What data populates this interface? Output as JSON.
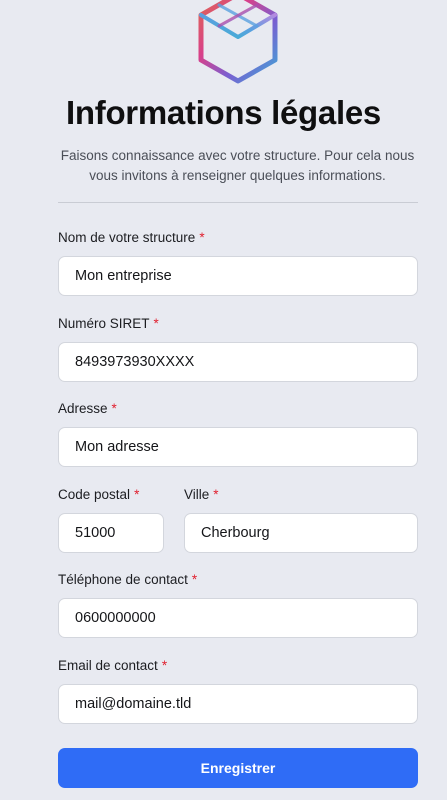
{
  "header": {
    "title": "Informations légales",
    "subtitle": "Faisons connaissance avec votre structure. Pour cela nous vous invitons à renseigner quelques informations."
  },
  "form": {
    "required_marker": "*",
    "fields": {
      "structure_name": {
        "label": "Nom de votre structure",
        "value": "Mon entreprise"
      },
      "siret": {
        "label": "Numéro SIRET",
        "value": "8493973930XXXX"
      },
      "address": {
        "label": "Adresse",
        "value": "Mon adresse"
      },
      "postal_code": {
        "label": "Code postal",
        "value": "51000"
      },
      "city": {
        "label": "Ville",
        "value": "Cherbourg"
      },
      "phone": {
        "label": "Téléphone de contact",
        "value": "0600000000"
      },
      "email": {
        "label": "Email de contact",
        "value": "mail@domaine.tld"
      }
    },
    "submit_label": "Enregistrer"
  },
  "logo": {
    "icon": "hexagon-cube-logo-icon"
  },
  "colors": {
    "background": "#e8eaf1",
    "accent": "#2f6cf6",
    "required": "#e0202f"
  }
}
